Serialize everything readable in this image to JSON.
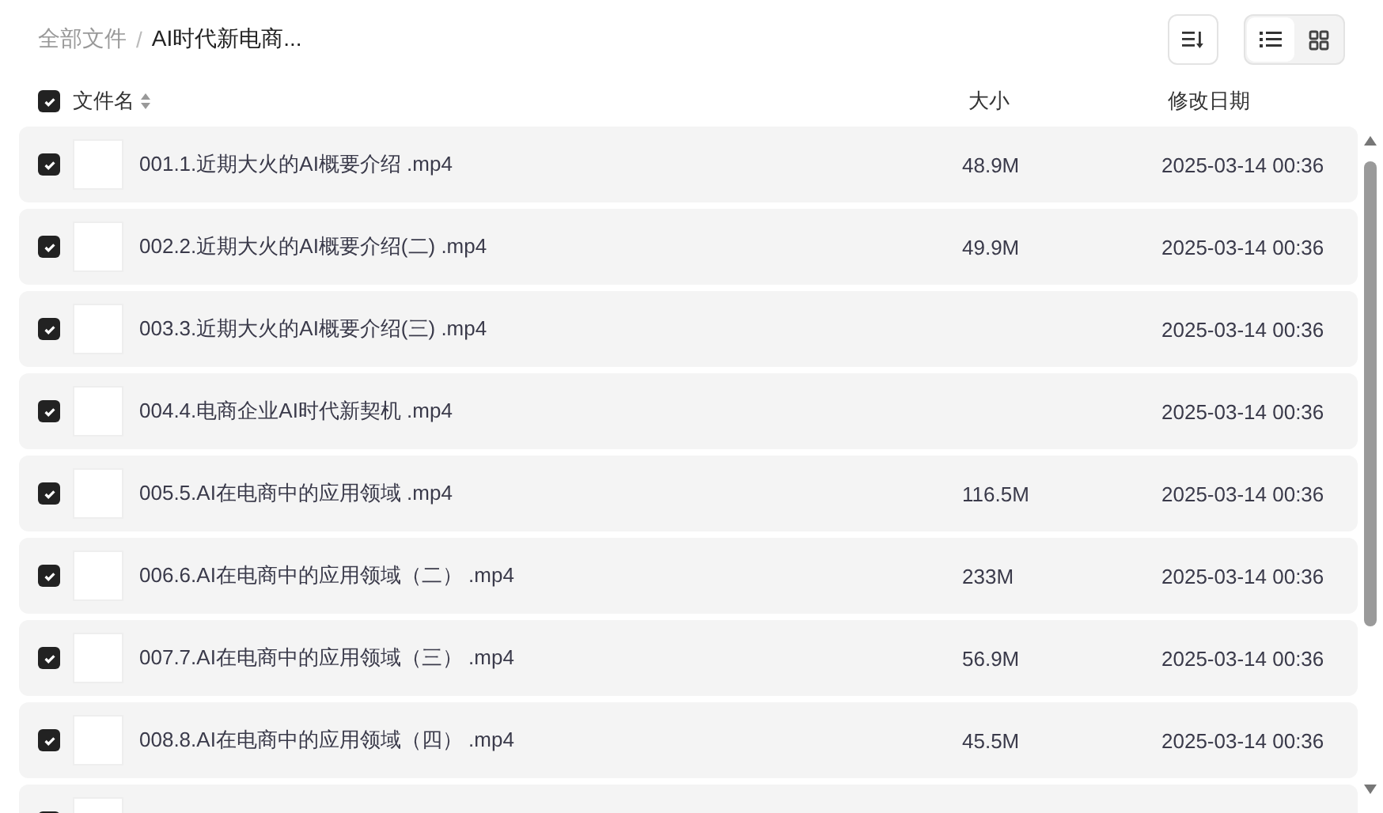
{
  "breadcrumb_separator": "/",
  "breadcrumb": [
    {
      "label": "全部文件",
      "current": false
    },
    {
      "label": "AI时代新电商...",
      "current": true
    }
  ],
  "view_toggle": [
    {
      "kind": "list",
      "selected": true
    },
    {
      "kind": "grid",
      "selected": false
    }
  ],
  "header": {
    "checked": true,
    "name": "文件名",
    "size": "大小",
    "date": "修改日期"
  },
  "rows": [
    {
      "checked": true,
      "name": "001.1.近期大火的AI概要介绍 .mp4",
      "size": "48.9M",
      "date": "2025-03-14 00:36"
    },
    {
      "checked": true,
      "name": "002.2.近期大火的AI概要介绍(二) .mp4",
      "size": "49.9M",
      "date": "2025-03-14 00:36"
    },
    {
      "checked": true,
      "name": "003.3.近期大火的AI概要介绍(三) .mp4",
      "date": "2025-03-14 00:36"
    },
    {
      "checked": true,
      "name": "004.4.电商企业AI时代新契机 .mp4",
      "date": "2025-03-14 00:36"
    },
    {
      "checked": true,
      "name": "005.5.AI在电商中的应用领域 .mp4",
      "size": "116.5M",
      "date": "2025-03-14 00:36"
    },
    {
      "checked": true,
      "name": "006.6.AI在电商中的应用领域（二） .mp4",
      "size": "233M",
      "date": "2025-03-14 00:36"
    },
    {
      "checked": true,
      "name": "007.7.AI在电商中的应用领域（三） .mp4",
      "size": "56.9M",
      "date": "2025-03-14 00:36"
    },
    {
      "checked": true,
      "name": "008.8.AI在电商中的应用领域（四） .mp4",
      "size": "45.5M",
      "date": "2025-03-14 00:36"
    },
    {
      "checked": true
    }
  ]
}
